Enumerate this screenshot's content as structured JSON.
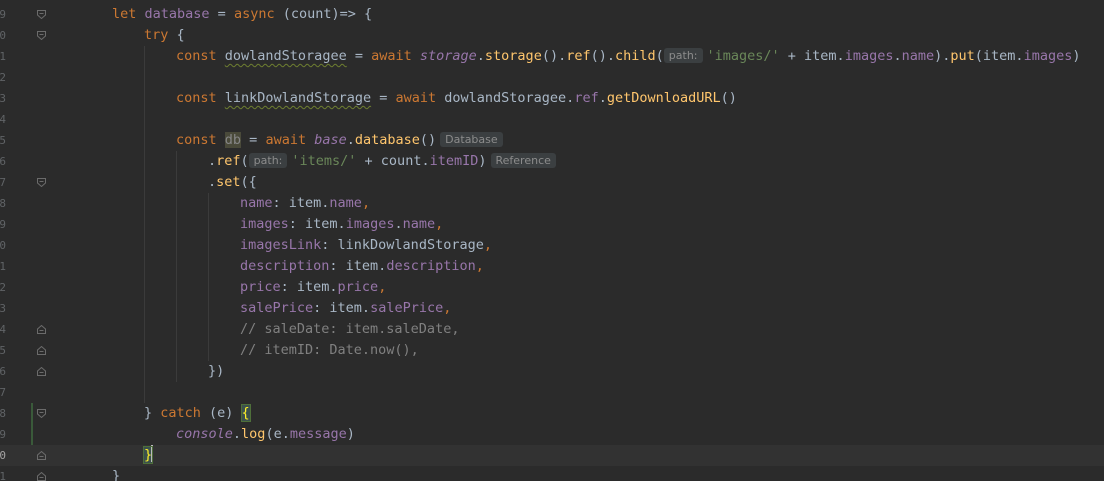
{
  "gutter": {
    "line_numbers": [
      "9",
      "0",
      "1",
      "2",
      "3",
      "4",
      "5",
      "6",
      "7",
      "8",
      "9",
      "0",
      "1",
      "2",
      "3",
      "4",
      "5",
      "6",
      "7",
      "8",
      "9",
      "0",
      "1"
    ],
    "current_line_number": "0"
  },
  "code": {
    "l1": {
      "kw": "let ",
      "name": "database",
      "op": " = ",
      "async": "async",
      "rest": " (count)=> {"
    },
    "l2": {
      "kw": "try",
      "rest": " {"
    },
    "l3": {
      "const": "const ",
      "var": "dowlandStoragee",
      "eq": " = ",
      "await": "await ",
      "storage1": "storage",
      "dot1": ".",
      "storage2": "storage",
      "p1": "().",
      "ref": "ref",
      "p2": "().",
      "child": "child",
      "p3": "(",
      "hint": "path:",
      "str": "'images/'",
      "plus": " + item.",
      "images1": "images",
      "dot2": ".",
      "name": "name",
      "p4": ").",
      "put": "put",
      "p5": "(item.",
      "images2": "images",
      "p6": ")"
    },
    "l5": {
      "const": "const ",
      "var": "linkDowlandStorage",
      "eq": " = ",
      "await": "await ",
      "obj": "dowlandStoragee.",
      "ref": "ref",
      "dot": ".",
      "fn": "getDownloadURL",
      "p": "()"
    },
    "l7": {
      "const": "const ",
      "var": "db",
      "eq": " = ",
      "await": "await ",
      "base": "base",
      "dot": ".",
      "fn": "database",
      "p": "()",
      "hint": "Database"
    },
    "l8": {
      "dot": ".",
      "fn": "ref",
      "p1": "(",
      "hint": "path:",
      "str": "'items/'",
      "plus": " + count.",
      "prop": "itemID",
      "p2": ")",
      "hint2": "Reference"
    },
    "l9": {
      "dot": ".",
      "fn": "set",
      "p": "({"
    },
    "l10": {
      "key": "name",
      "colon": ": item.",
      "val": "name",
      "comma": ","
    },
    "l11": {
      "key": "images",
      "colon": ": item.",
      "val1": "images",
      "dot": ".",
      "val2": "name",
      "comma": ","
    },
    "l12": {
      "key": "imagesLink",
      "colon": ": linkDowlandStorage",
      "comma": ","
    },
    "l13": {
      "key": "description",
      "colon": ": item.",
      "val": "description",
      "comma": ","
    },
    "l14": {
      "key": "price",
      "colon": ": item.",
      "val": "price",
      "comma": ","
    },
    "l15": {
      "key": "salePrice",
      "colon": ": item.",
      "val": "salePrice",
      "comma": ","
    },
    "l16": {
      "text": "// saleDate: item.saleDate,"
    },
    "l17": {
      "text": "// itemID: Date.now(),"
    },
    "l18": {
      "text": "})"
    },
    "l20": {
      "brace": "} ",
      "catch": "catch",
      "rest": " (e) ",
      "open": "{"
    },
    "l21": {
      "console": "console",
      "dot": ".",
      "log": "log",
      "p1": "(e.",
      "msg": "message",
      "p2": ")"
    },
    "l22": {
      "close": "}"
    },
    "l23": {
      "close": "}"
    }
  },
  "colors": {
    "background": "#2b2b2b",
    "keyword": "#cc7832",
    "function": "#ffc66d",
    "property": "#9876aa",
    "string": "#6a8759",
    "comment": "#808080",
    "text": "#a9b7c6"
  }
}
